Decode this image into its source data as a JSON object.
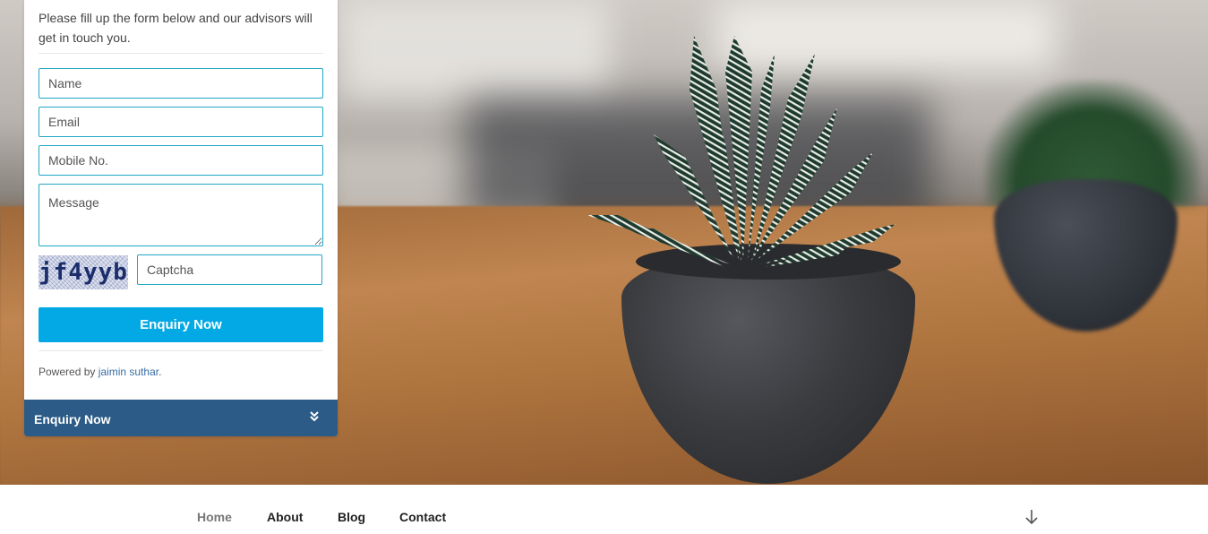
{
  "enquiry_form": {
    "intro": "Please fill up the form below and our advisors will get in touch you.",
    "fields": {
      "name_placeholder": "Name",
      "email_placeholder": "Email",
      "mobile_placeholder": "Mobile No.",
      "message_placeholder": "Message",
      "captcha_placeholder": "Captcha"
    },
    "captcha_text": "jf4yyb",
    "submit_label": "Enquiry Now",
    "powered_by_prefix": "Powered by",
    "powered_by_link": "jaimin suthar",
    "powered_by_suffix": ".",
    "toggle_label": "Enquiry Now",
    "toggle_icon": "double-chevron-down-icon",
    "colors": {
      "field_border": "#21a6c5",
      "submit_bg": "#03a9e4",
      "toggle_bg": "#2b5b86"
    }
  },
  "nav": {
    "items": [
      {
        "label": "Home",
        "active": true
      },
      {
        "label": "About",
        "active": false
      },
      {
        "label": "Blog",
        "active": false
      },
      {
        "label": "Contact",
        "active": false
      }
    ],
    "scroll_icon": "arrow-down-icon"
  }
}
